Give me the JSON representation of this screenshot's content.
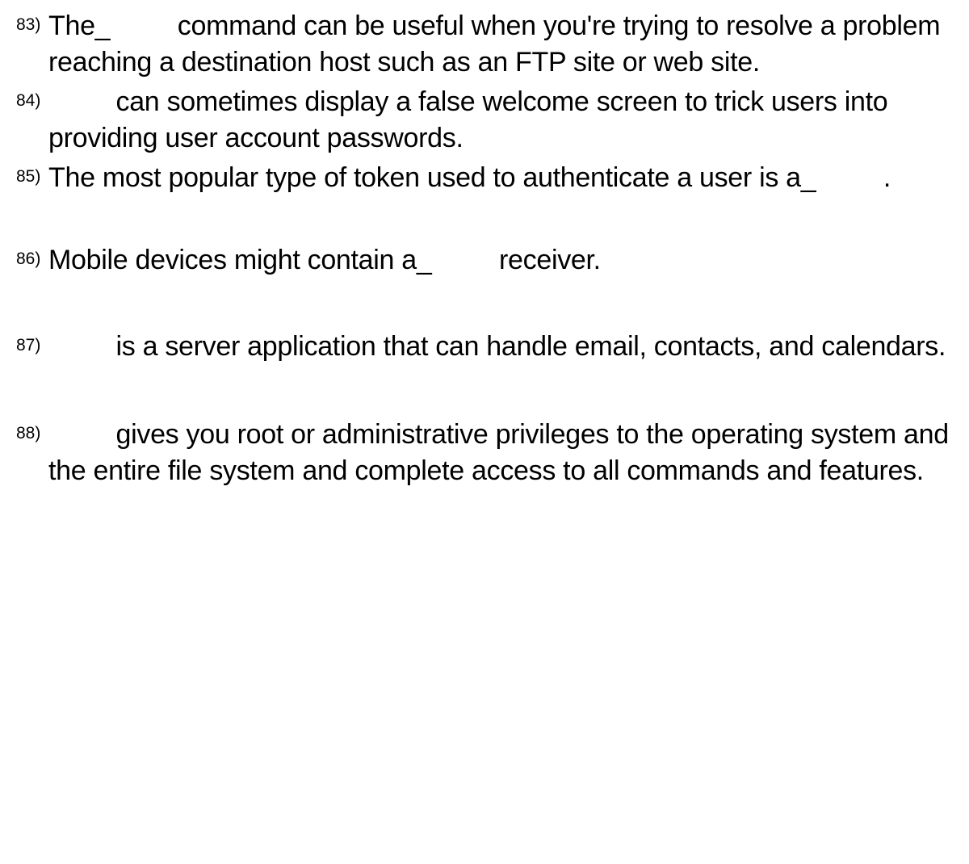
{
  "questions": [
    {
      "number": "83)",
      "text": "The_     command can be useful when you're trying to resolve a problem reaching a destination host such as an FTP site or web site."
    },
    {
      "number": "84)",
      "text": "     can sometimes display a false welcome screen to trick users into providing user account passwords."
    },
    {
      "number": "85)",
      "text": "The most popular type of token used to authenticate a user is a_     ."
    },
    {
      "number": "86)",
      "text": "Mobile devices might contain a_     receiver."
    },
    {
      "number": "87)",
      "text": "     is a server application that can handle email, contacts, and calendars."
    },
    {
      "number": "88)",
      "text": "     gives you root or administrative privileges to the operating system and the entire file system and complete access to all commands and features."
    }
  ]
}
